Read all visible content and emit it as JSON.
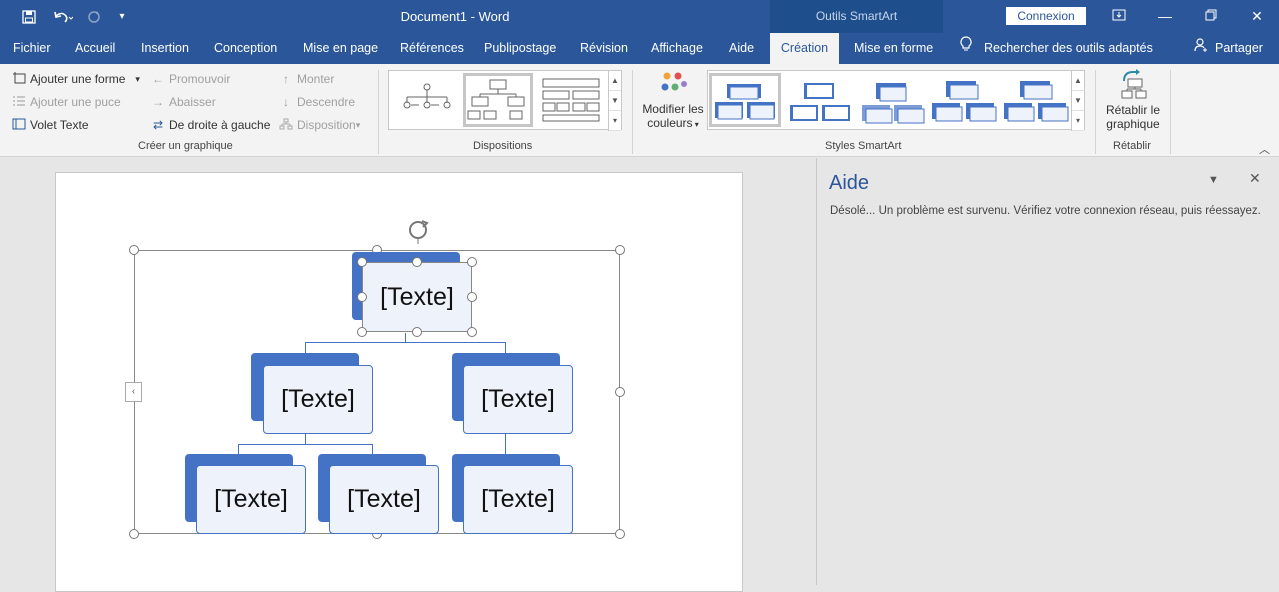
{
  "titlebar": {
    "title": "Document1  -  Word",
    "context_tab": "Outils SmartArt",
    "login_button": "Connexion",
    "icons": [
      "save-icon",
      "undo-icon",
      "redo-icon",
      "customize-icon",
      "ribbon-display-icon",
      "minimize-icon",
      "restore-icon",
      "close-icon"
    ]
  },
  "tabs": [
    "Fichier",
    "Accueil",
    "Insertion",
    "Conception",
    "Mise en page",
    "Références",
    "Publipostage",
    "Révision",
    "Affichage",
    "Aide",
    "Création",
    "Mise en forme"
  ],
  "active_tab": "Création",
  "search_tools": "Rechercher des outils adaptés",
  "share": "Partager",
  "ribbon": {
    "creer": {
      "add_shape": "Ajouter une forme",
      "add_bullet": "Ajouter une puce",
      "text_pane": "Volet Texte",
      "promote": "Promouvoir",
      "demote": "Abaisser",
      "rtl": "De droite à gauche",
      "move_up": "Monter",
      "move_down": "Descendre",
      "layout": "Disposition",
      "group_label": "Créer un graphique"
    },
    "dispositions": {
      "group_label": "Dispositions"
    },
    "styles": {
      "change_colors_line1": "Modifier les",
      "change_colors_line2": "couleurs",
      "group_label": "Styles SmartArt"
    },
    "retablir": {
      "reset_line1": "Rétablir le",
      "reset_line2": "graphique",
      "group_label": "Rétablir"
    }
  },
  "help_pane": {
    "title": "Aide",
    "message": "Désolé... Un problème est survenu. Vérifiez votre connexion réseau, puis réessayez."
  },
  "smartart": {
    "nodes": [
      "[Texte]",
      "[Texte]",
      "[Texte]",
      "[Texte]",
      "[Texte]",
      "[Texte]"
    ]
  },
  "colors": {
    "brand": "#2b579a",
    "shape": "#4472c4",
    "shape_fill": "#eef2fa"
  }
}
